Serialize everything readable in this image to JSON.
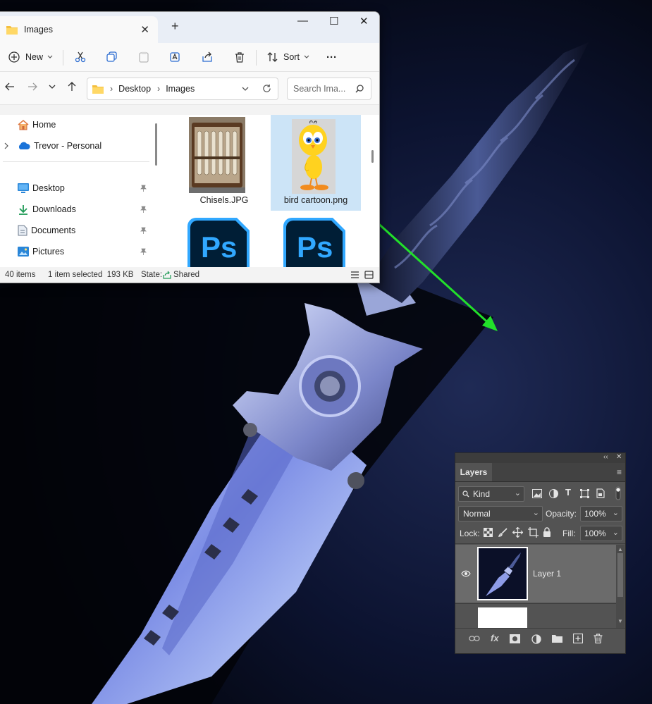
{
  "explorer": {
    "tab_title": "Images",
    "tab_close": "✕",
    "new_tab": "+",
    "window_controls": {
      "minimize": "—",
      "maximize": "☐",
      "close": "✕"
    },
    "toolbar": {
      "new_label": "New",
      "sort_label": "Sort",
      "more_label": "···"
    },
    "breadcrumb": [
      "Desktop",
      "Images"
    ],
    "breadcrumb_sep": "›",
    "search_placeholder": "Search Ima...",
    "nav_items": [
      {
        "label": "Home",
        "icon": "home-icon"
      },
      {
        "label": "Trevor - Personal",
        "icon": "onedrive-icon"
      },
      {
        "label": "Desktop",
        "icon": "desktop-icon",
        "pinned": true
      },
      {
        "label": "Downloads",
        "icon": "download-icon",
        "pinned": true
      },
      {
        "label": "Documents",
        "icon": "documents-icon",
        "pinned": true
      },
      {
        "label": "Pictures",
        "icon": "pictures-icon",
        "pinned": true
      }
    ],
    "files": [
      {
        "name": "Chisels.JPG",
        "selected": false
      },
      {
        "name": "bird cartoon.png",
        "selected": true
      },
      {
        "name": "",
        "type_label": "Ps"
      },
      {
        "name": "",
        "type_label": "Ps"
      }
    ],
    "status": {
      "items": "40 items",
      "selected": "1 item selected  193 KB",
      "state_label": "State:",
      "state_value": "Shared"
    }
  },
  "layers_panel": {
    "title": "Layers",
    "kind_label": "Kind",
    "blend_mode": "Normal",
    "opacity_label": "Opacity:",
    "opacity_value": "100%",
    "lock_label": "Lock:",
    "fill_label": "Fill:",
    "fill_value": "100%",
    "layers": [
      {
        "name": "Layer 1",
        "visible": true,
        "active": true
      },
      {
        "name": "",
        "visible": false,
        "active": false
      }
    ]
  },
  "colors": {
    "drag_arrow": "#22e02a",
    "explorer_bg": "#f3f3f3",
    "selection": "#cce4f7",
    "ps_blue": "#31a8ff",
    "ps_dark": "#001e36",
    "panel_bg": "#535353"
  }
}
